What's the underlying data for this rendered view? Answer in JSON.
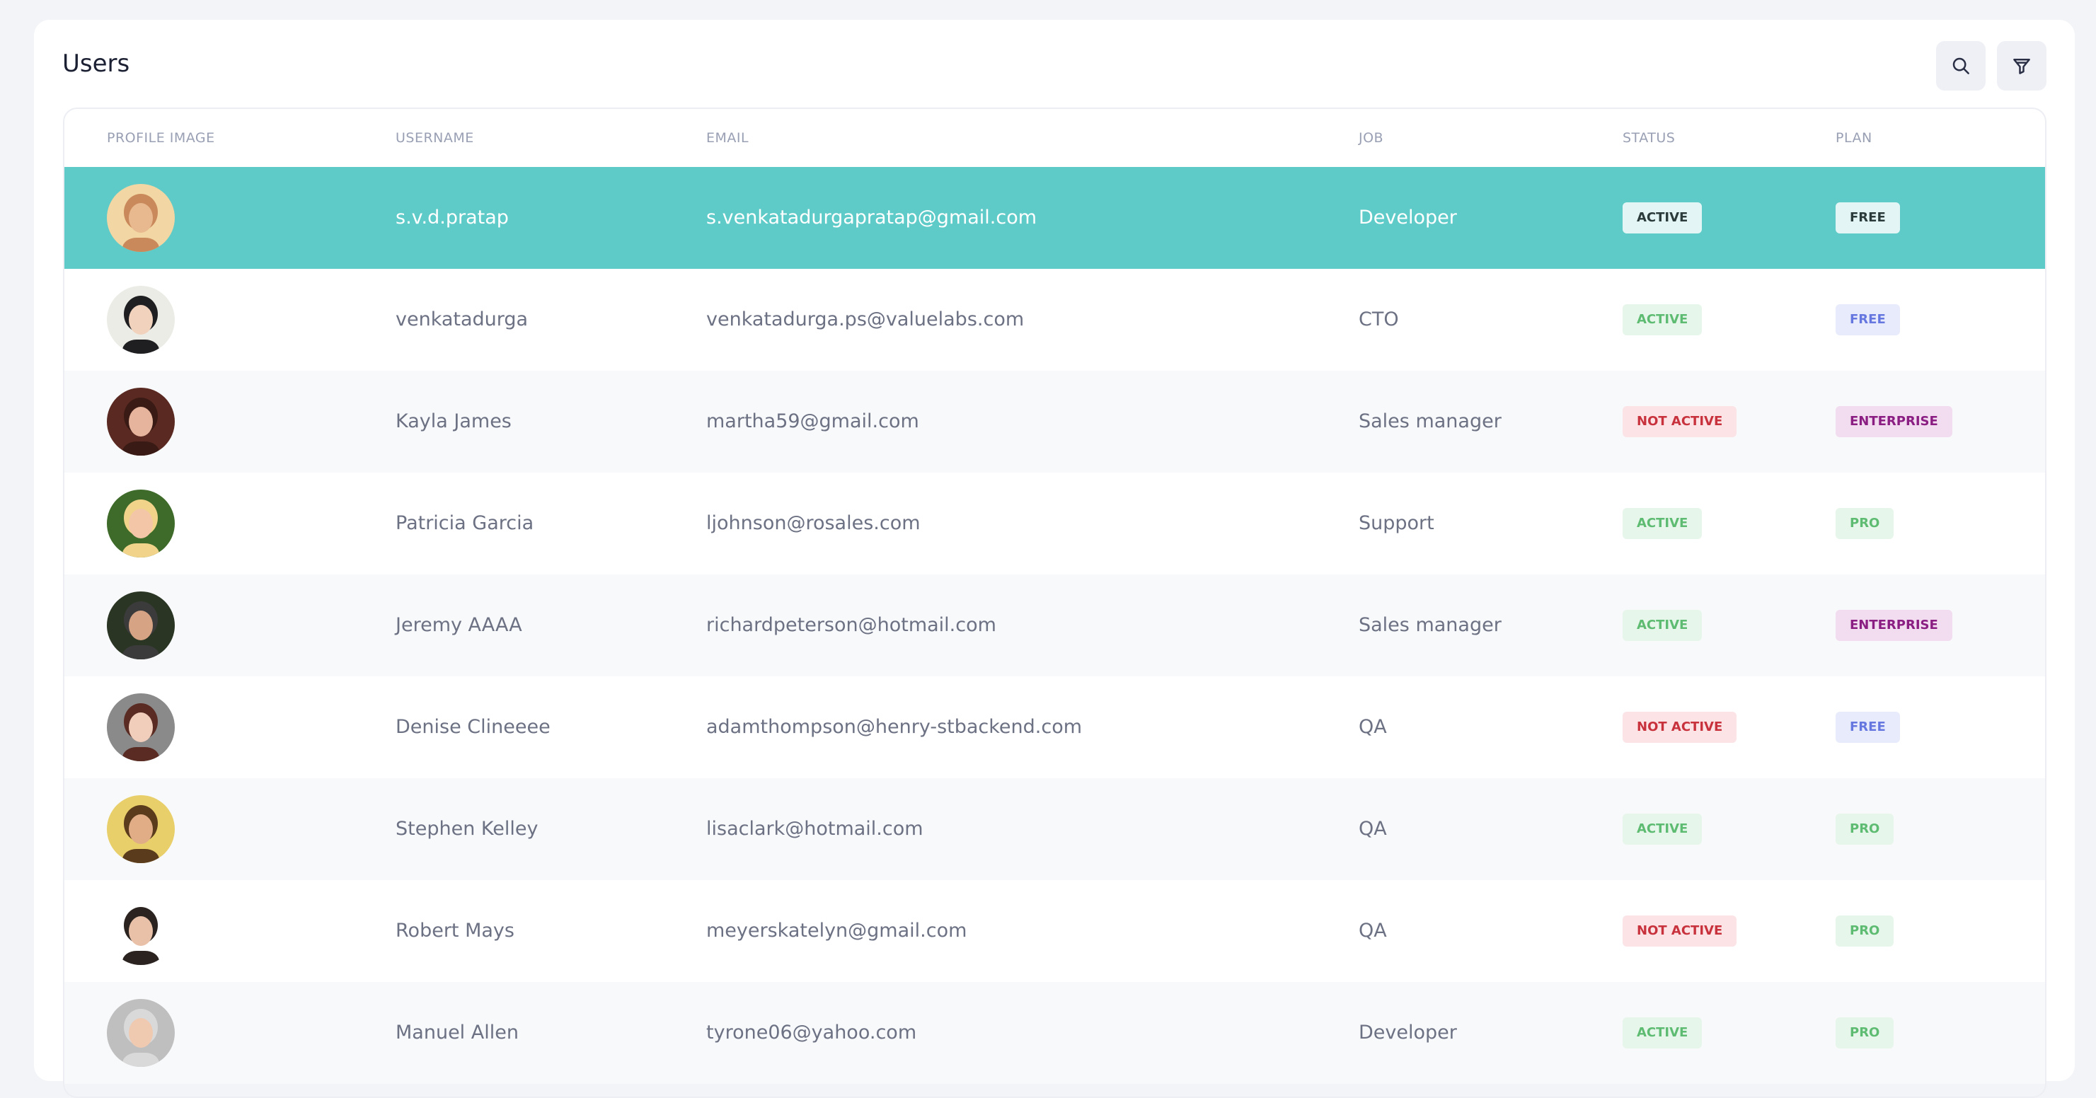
{
  "page": {
    "title": "Users"
  },
  "toolbar": {
    "search_icon": "search-icon",
    "filter_icon": "filter-icon"
  },
  "table": {
    "columns": {
      "profile_image": "PROFILE IMAGE",
      "username": "USERNAME",
      "email": "EMAIL",
      "job": "JOB",
      "status": "STATUS",
      "plan": "PLAN"
    },
    "rows": [
      {
        "username": "s.v.d.pratap",
        "email": "s.venkatadurgapratap@gmail.com",
        "job": "Developer",
        "status": "ACTIVE",
        "plan": "FREE",
        "selected": true
      },
      {
        "username": "venkatadurga",
        "email": "venkatadurga.ps@valuelabs.com",
        "job": "CTO",
        "status": "ACTIVE",
        "plan": "FREE"
      },
      {
        "username": "Kayla James",
        "email": "martha59@gmail.com",
        "job": "Sales manager",
        "status": "NOT ACTIVE",
        "plan": "ENTERPRISE"
      },
      {
        "username": "Patricia Garcia",
        "email": "ljohnson@rosales.com",
        "job": "Support",
        "status": "ACTIVE",
        "plan": "PRO"
      },
      {
        "username": "Jeremy AAAA",
        "email": "richardpeterson@hotmail.com",
        "job": "Sales manager",
        "status": "ACTIVE",
        "plan": "ENTERPRISE"
      },
      {
        "username": "Denise Clineeee",
        "email": "adamthompson@henry-stbackend.com",
        "job": "QA",
        "status": "NOT ACTIVE",
        "plan": "FREE"
      },
      {
        "username": "Stephen Kelley",
        "email": "lisaclark@hotmail.com",
        "job": "QA",
        "status": "ACTIVE",
        "plan": "PRO"
      },
      {
        "username": "Robert Mays",
        "email": "meyerskatelyn@gmail.com",
        "job": "QA",
        "status": "NOT ACTIVE",
        "plan": "PRO"
      },
      {
        "username": "Manuel Allen",
        "email": "tyrone06@yahoo.com",
        "job": "Developer",
        "status": "ACTIVE",
        "plan": "PRO"
      }
    ]
  },
  "colors": {
    "selected_row": "#5ecbc8",
    "active": "#5dbb72",
    "not_active": "#c8323c",
    "free": "#6677e0",
    "enterprise": "#8a1e82"
  }
}
